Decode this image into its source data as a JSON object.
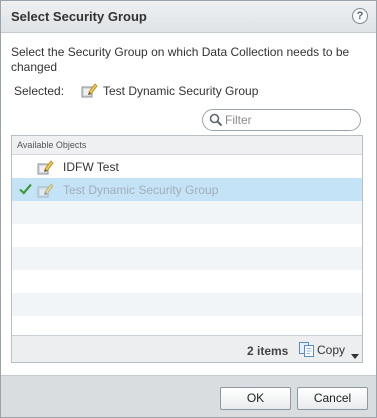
{
  "dialog": {
    "title": "Select Security Group",
    "help_icon_glyph": "?",
    "instructions": "Select the Security Group on which Data Collection needs to be changed",
    "selected_label": "Selected:",
    "selected_value": "Test Dynamic Security Group",
    "selected_icon": "security-group-icon"
  },
  "filter": {
    "placeholder": "Filter",
    "value": ""
  },
  "grid": {
    "header": "Available Objects",
    "rows": [
      {
        "label": "IDFW Test",
        "icon": "security-group-icon",
        "selected": false
      },
      {
        "label": "Test Dynamic Security Group",
        "icon": "security-group-icon",
        "selected": true
      }
    ],
    "item_count": "2 items",
    "copy_label": "Copy"
  },
  "buttons": {
    "ok": "OK",
    "cancel": "Cancel"
  },
  "colors": {
    "selection": "#c4e3f6",
    "titlebar": "#dfe3e6",
    "checkmark": "#3f9a3a"
  }
}
